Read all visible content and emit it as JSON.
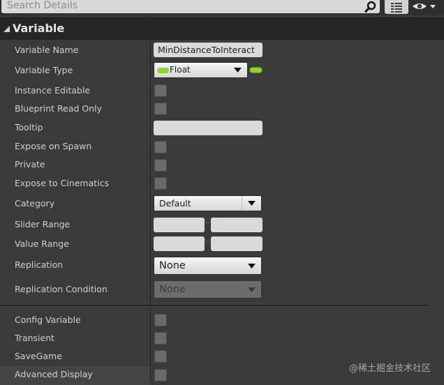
{
  "search": {
    "placeholder": "Search Details"
  },
  "category": {
    "title": "Variable"
  },
  "fields": {
    "variable_name": {
      "label": "Variable Name",
      "value": "MinDistanceToInteract"
    },
    "variable_type": {
      "label": "Variable Type",
      "value": "Float",
      "pill_color": "#8fd42a"
    },
    "instance_editable": {
      "label": "Instance Editable",
      "checked": false
    },
    "blueprint_read_only": {
      "label": "Blueprint Read Only",
      "checked": false
    },
    "tooltip": {
      "label": "Tooltip",
      "value": ""
    },
    "expose_on_spawn": {
      "label": "Expose on Spawn",
      "checked": false
    },
    "private": {
      "label": "Private",
      "checked": false
    },
    "expose_to_cinematics": {
      "label": "Expose to Cinematics",
      "checked": false
    },
    "category_field": {
      "label": "Category",
      "value": "Default"
    },
    "slider_range": {
      "label": "Slider Range",
      "min": "",
      "max": "",
      "separator": ".."
    },
    "value_range": {
      "label": "Value Range",
      "min": "",
      "max": "",
      "separator": ".."
    },
    "replication": {
      "label": "Replication",
      "value": "None"
    },
    "replication_condition": {
      "label": "Replication Condition",
      "value": "None",
      "enabled": false
    }
  },
  "advanced_fields": {
    "config_variable": {
      "label": "Config Variable",
      "checked": false
    },
    "transient": {
      "label": "Transient",
      "checked": false
    },
    "save_game": {
      "label": "SaveGame",
      "checked": false
    },
    "advanced_display": {
      "label": "Advanced Display",
      "checked": false
    }
  },
  "watermark": "@稀土掘金技术社区",
  "colors": {
    "panel": "#3a3a3a",
    "header": "#262626",
    "float_type": "#8fd42a"
  }
}
